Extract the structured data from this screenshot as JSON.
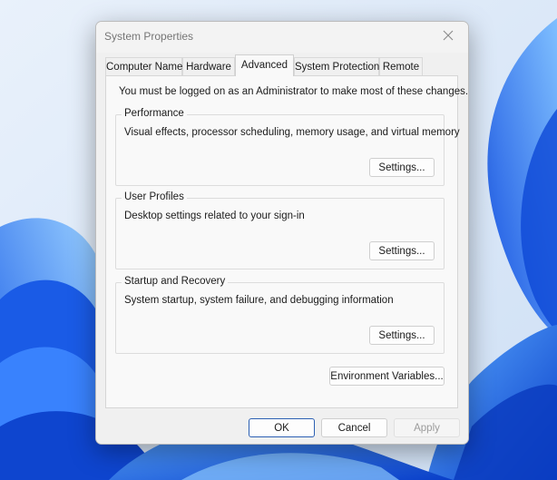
{
  "window": {
    "title": "System Properties"
  },
  "tabs": [
    {
      "label": "Computer Name",
      "active": false
    },
    {
      "label": "Hardware",
      "active": false
    },
    {
      "label": "Advanced",
      "active": true
    },
    {
      "label": "System Protection",
      "active": false
    },
    {
      "label": "Remote",
      "active": false
    }
  ],
  "advanced": {
    "admin_note": "You must be logged on as an Administrator to make most of these changes.",
    "performance": {
      "title": "Performance",
      "description": "Visual effects, processor scheduling, memory usage, and virtual memory",
      "button": "Settings..."
    },
    "user_profiles": {
      "title": "User Profiles",
      "description": "Desktop settings related to your sign-in",
      "button": "Settings..."
    },
    "startup_recovery": {
      "title": "Startup and Recovery",
      "description": "System startup, system failure, and debugging information",
      "button": "Settings..."
    },
    "environment_variables_button": "Environment Variables..."
  },
  "footer": {
    "ok": "OK",
    "cancel": "Cancel",
    "apply": "Apply"
  },
  "colors": {
    "accent": "#2b5fb3",
    "dialog_bg": "#f0f0f0",
    "panel_bg": "#f9f9f9",
    "wallpaper_bg": "#dfeaf7",
    "wallpaper_bloom": "#1a63e8"
  },
  "icons": {
    "close": "close-icon"
  }
}
